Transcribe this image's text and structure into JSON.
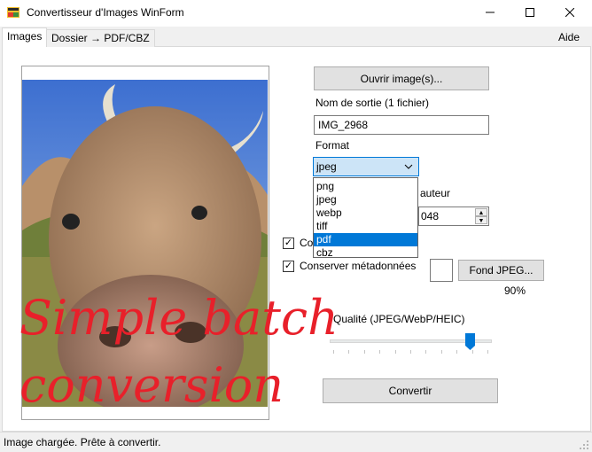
{
  "window": {
    "title": "Convertisseur d'Images WinForm",
    "minimize_icon": "minimize-icon",
    "maximize_icon": "maximize-icon",
    "close_icon": "close-icon"
  },
  "tabs": [
    {
      "label": "Images",
      "active": true
    },
    {
      "label": "Dossier → PDF/CBZ",
      "active": false
    }
  ],
  "menu": {
    "help": "Aide"
  },
  "preview": {
    "image": "cow-photo",
    "overlay_lines": [
      "Simple batch",
      "conversion"
    ]
  },
  "controls": {
    "open_button": "Ouvrir image(s)...",
    "output_name_label": "Nom de sortie (1 fichier)",
    "output_name_value": "IMG_2968",
    "format_label": "Format",
    "format_selected": "jpeg",
    "format_options": [
      "png",
      "jpeg",
      "webp",
      "tiff",
      "pdf",
      "cbz"
    ],
    "format_highlighted": "pdf",
    "height_label": "Hauteur",
    "height_label_visible": "auteur",
    "height_value_visible": "048",
    "checkbox_1_label_visible": "Co",
    "checkbox_1_checked": true,
    "checkbox_2_label": "Conserver métadonnées",
    "checkbox_2_checked": true,
    "jpeg_bg_button": "Fond JPEG...",
    "jpeg_bg_color": "#ffffff",
    "quality_value_text": "90%",
    "quality_label": "Qualité (JPEG/WebP/HEIC)",
    "quality_level": 90,
    "convert_button": "Convertir"
  },
  "status": {
    "text": "Image chargée. Prête à convertir."
  },
  "colors": {
    "accent": "#0078d7",
    "overlay_text": "#e8202a",
    "select_background": "#cce4f7"
  }
}
